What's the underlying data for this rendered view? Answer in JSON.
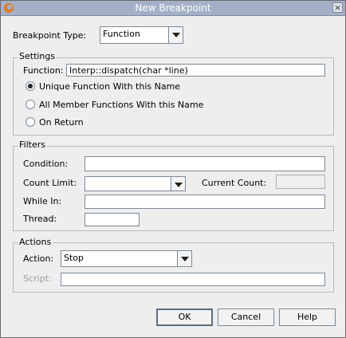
{
  "window": {
    "title": "New Breakpoint"
  },
  "breakpoint_type": {
    "label": "Breakpoint Type:",
    "value": "Function"
  },
  "settings": {
    "legend": "Settings",
    "function_label": "Function:",
    "function_value": "Interp::dispatch(char *line)",
    "options": [
      {
        "label": "Unique Function With this Name",
        "selected": true
      },
      {
        "label": "All Member Functions With this Name",
        "selected": false
      },
      {
        "label": "On Return",
        "selected": false
      }
    ]
  },
  "filters": {
    "legend": "Filters",
    "condition_label": "Condition:",
    "condition_value": "",
    "count_limit_label": "Count Limit:",
    "count_limit_value": "",
    "current_count_label": "Current Count:",
    "current_count_value": "",
    "while_in_label": "While In:",
    "while_in_value": "",
    "thread_label": "Thread:",
    "thread_value": ""
  },
  "actions": {
    "legend": "Actions",
    "action_label": "Action:",
    "action_value": "Stop",
    "script_label": "Script:",
    "script_value": ""
  },
  "buttons": {
    "ok": "OK",
    "cancel": "Cancel",
    "help": "Help"
  },
  "colors": {
    "titlebar": "#a3b0c7",
    "background": "#eeeeee"
  }
}
